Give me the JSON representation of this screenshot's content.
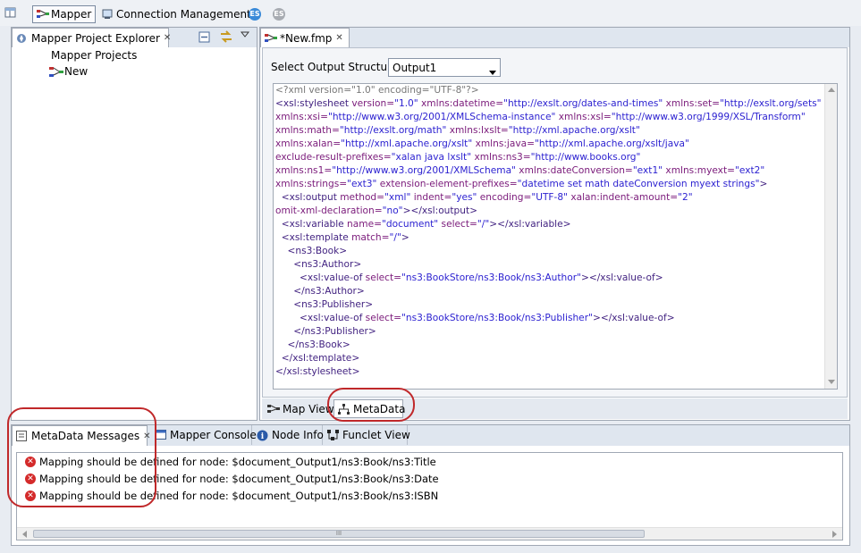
{
  "toolbar": {
    "mapper": "Mapper",
    "connection": "Connection Management"
  },
  "explorer": {
    "tab": "Mapper Project Explorer",
    "root": "Mapper Projects",
    "item": "New"
  },
  "editor": {
    "tab": "*New.fmp",
    "output_label": "Select Output Structure:",
    "output_value": "Output1"
  },
  "bottom_tabs": {
    "map_view": "Map View",
    "metadata": "MetaData"
  },
  "messages_tabs": {
    "metadata_messages": "MetaData Messages",
    "mapper_console": "Mapper Console",
    "node_info": "Node Info",
    "funclet_view": "Funclet View"
  },
  "messages": [
    "Mapping should be defined for node: $document_Output1/ns3:Book/ns3:Title",
    "Mapping should be defined for node: $document_Output1/ns3:Book/ns3:Date",
    "Mapping should be defined for node: $document_Output1/ns3:Book/ns3:ISBN"
  ],
  "scroll_grip": "III",
  "xml_lines": [
    "<?xml version=\"1.0\" encoding=\"UTF-8\"?>",
    "<xsl:stylesheet version=\"1.0\" xmlns:datetime=\"http://exslt.org/dates-and-times\" xmlns:set=\"http://exslt.org/sets\"",
    "xmlns:xsi=\"http://www.w3.org/2001/XMLSchema-instance\" xmlns:xsl=\"http://www.w3.org/1999/XSL/Transform\"",
    "xmlns:math=\"http://exslt.org/math\" xmlns:lxslt=\"http://xml.apache.org/xslt\"",
    "xmlns:xalan=\"http://xml.apache.org/xslt\" xmlns:java=\"http://xml.apache.org/xslt/java\"",
    "exclude-result-prefixes=\"xalan java lxslt\" xmlns:ns3=\"http://www.books.org\"",
    "xmlns:ns1=\"http://www.w3.org/2001/XMLSchema\" xmlns:dateConversion=\"ext1\" xmlns:myext=\"ext2\"",
    "xmlns:strings=\"ext3\" extension-element-prefixes=\"datetime set math dateConversion myext strings\">",
    "  <xsl:output method=\"xml\" indent=\"yes\" encoding=\"UTF-8\" xalan:indent-amount=\"2\"",
    "omit-xml-declaration=\"no\"></xsl:output>",
    "  <xsl:variable name=\"document\" select=\"/\"></xsl:variable>",
    "  <xsl:template match=\"/\">",
    "    <ns3:Book>",
    "      <ns3:Author>",
    "        <xsl:value-of select=\"ns3:BookStore/ns3:Book/ns3:Author\"></xsl:value-of>",
    "      </ns3:Author>",
    "      <ns3:Publisher>",
    "        <xsl:value-of select=\"ns3:BookStore/ns3:Book/ns3:Publisher\"></xsl:value-of>",
    "      </ns3:Publisher>",
    "    </ns3:Book>",
    "  </xsl:template>",
    "</xsl:stylesheet>"
  ]
}
